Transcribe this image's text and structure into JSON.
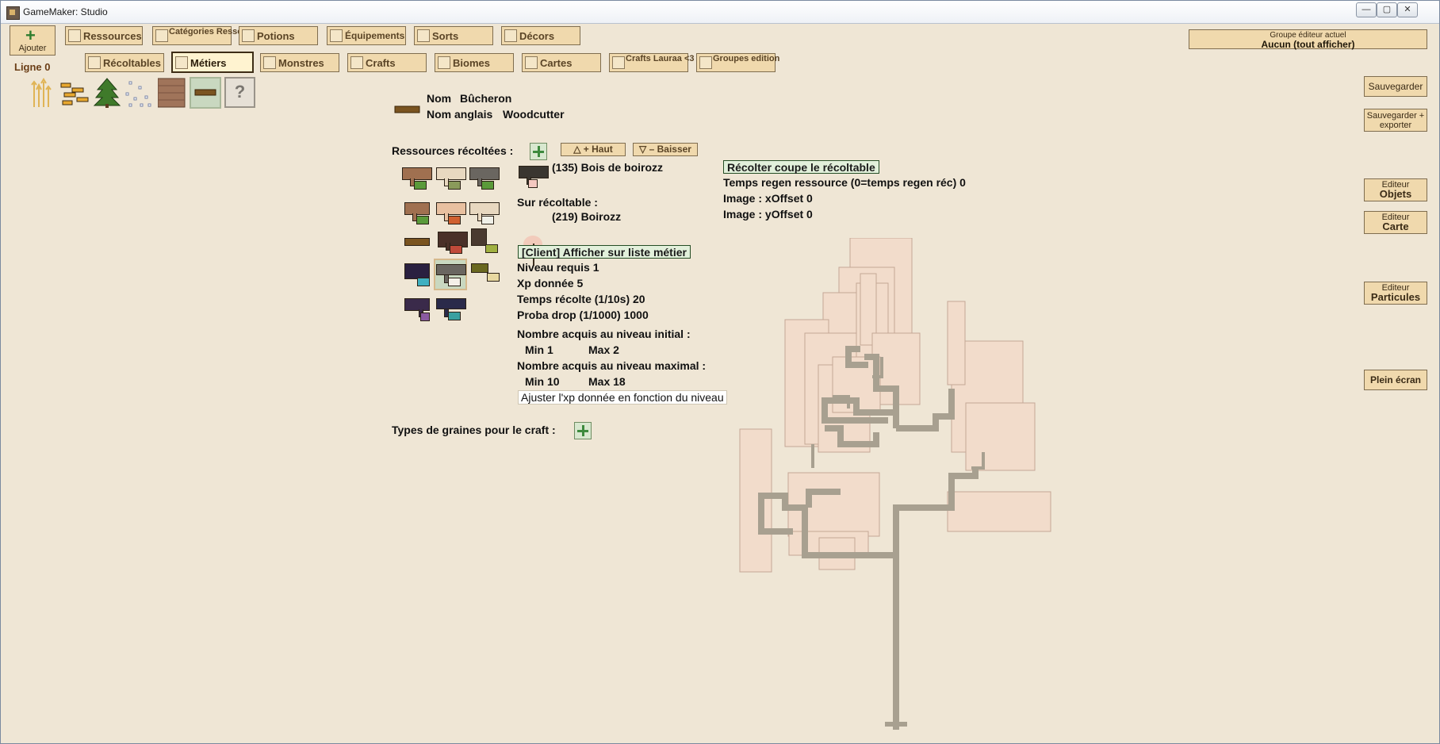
{
  "window": {
    "title": "GameMaker: Studio",
    "minimize_glyph": "—",
    "maximize_glyph": "▢",
    "close_glyph": "✕"
  },
  "toolbar": {
    "add_label": "Ajouter",
    "add_glyph": "+",
    "row_label": "Ligne 0",
    "tabs_row1": [
      {
        "label": "Ressources"
      },
      {
        "label": "Catégories Ressources"
      },
      {
        "label": "Potions"
      },
      {
        "label": "Équipements"
      },
      {
        "label": "Sorts"
      },
      {
        "label": "Décors"
      }
    ],
    "tabs_row2": [
      {
        "label": "Récoltables"
      },
      {
        "label": "Métiers"
      },
      {
        "label": "Monstres"
      },
      {
        "label": "Crafts"
      },
      {
        "label": "Biomes"
      },
      {
        "label": "Cartes"
      },
      {
        "label": "Crafts Lauraa <3"
      },
      {
        "label": "Groupes edition"
      }
    ],
    "active_tab": "Métiers"
  },
  "group_editor": {
    "label": "Groupe éditeur actuel",
    "value": "Aucun (tout afficher)"
  },
  "side_buttons": {
    "save": "Sauvegarder",
    "save_export": "Sauvegarder + exporter",
    "editor_objects_small": "Editeur",
    "editor_objects_big": "Objets",
    "editor_map_small": "Editeur",
    "editor_map_big": "Carte",
    "editor_particles_small": "Editeur",
    "editor_particles_big": "Particules",
    "fullscreen": "Plein écran"
  },
  "palette": {
    "items": [
      "wheat-icon",
      "bricks-icon",
      "pine-tree-icon",
      "dots-icon",
      "brick-wall-icon",
      "plank-icon"
    ],
    "unknown_glyph": "?"
  },
  "job": {
    "name_label": "Nom",
    "name_value": "Bûcheron",
    "name_en_label": "Nom anglais",
    "name_en_value": "Woodcutter",
    "resources_label": "Ressources récoltées :",
    "up_label": "+ Haut",
    "up_glyph": "△",
    "down_label": "– Baisser",
    "down_glyph": "▽",
    "selected_resource": "(135) Bois de boirozz",
    "on_harvestable_label": "Sur récoltable :",
    "harvestable_value": "(219) Boirozz",
    "show_on_list": "[Client] Afficher sur liste métier",
    "level_required": "Niveau requis  1",
    "xp_given": "Xp donnée  5",
    "harvest_time": "Temps récolte (1/10s)  20",
    "drop_proba": "Proba drop (1/1000)  1000",
    "acquired_initial_label": "Nombre acquis au niveau initial :",
    "initial_min": "Min  1",
    "initial_max": "Max  2",
    "acquired_max_label": "Nombre acquis au niveau maximal :",
    "maximal_min": "Min  10",
    "maximal_max": "Max  18",
    "adjust_xp": "Ajuster l'xp donnée en fonction du niveau",
    "seeds_label": "Types de graines pour le craft :",
    "cut_harvestable": "Récolter coupe le récoltable",
    "regen_time": "Temps regen ressource (0=temps regen réc)  0",
    "x_offset": "Image : xOffset  0",
    "y_offset": "Image : yOffset  0"
  },
  "colors": {
    "background": "#efe6d5",
    "button": "#f0d9ad",
    "button_border": "#7f6d4f",
    "button_text": "#5a4426",
    "highlight_green": "#e2f0db",
    "tree_leaf": "#f2dccb",
    "tree_branch": "#a8a090"
  }
}
